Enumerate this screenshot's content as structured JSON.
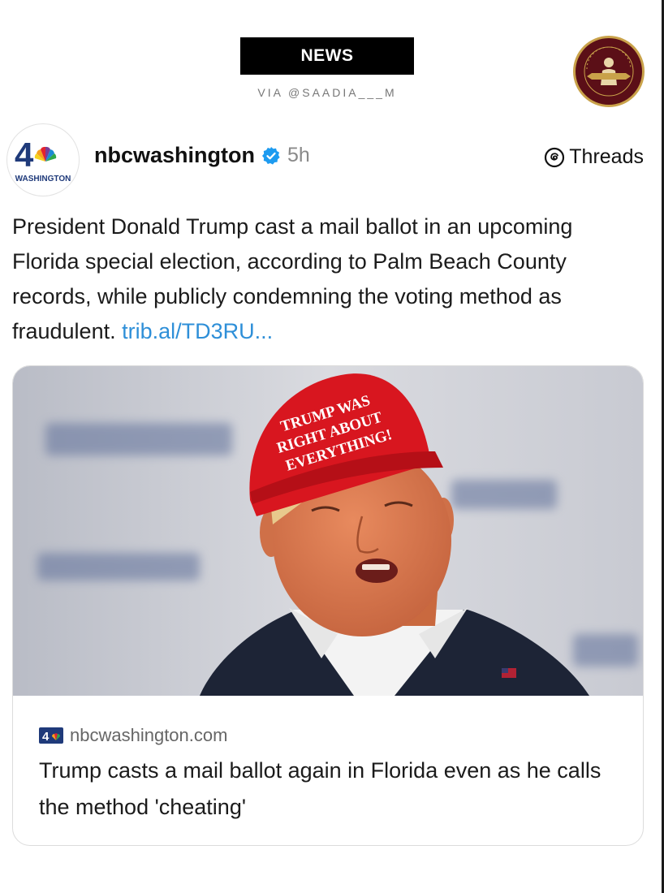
{
  "header": {
    "badge_label": "NEWS",
    "via_text": "VIA @SAADIA___M",
    "corner_logo_text": "TRUTH IS JUSTICE"
  },
  "post": {
    "avatar_number": "4",
    "avatar_caption": "WASHINGTON",
    "handle": "nbcwashington",
    "time": "5h",
    "platform": "Threads",
    "text": "President Donald Trump cast a mail ballot in an upcoming Florida special election, according to Palm Beach County records, while publicly condemning the voting method as fraudulent.",
    "link_text": "trib.al/TD3RU..."
  },
  "card": {
    "image_text": "TRUMP WAS RIGHT ABOUT EVERYTHING!",
    "source_domain": "nbcwashington.com",
    "title": "Trump casts a mail ballot again in Florida even as he calls the method 'cheating'"
  },
  "colors": {
    "link": "#2e8fd8",
    "verified": "#1d9bf0",
    "hat_red": "#d8161f",
    "logo_maroon": "#5b0f17",
    "logo_gold": "#c9a24a"
  },
  "icons": {
    "verified": "verified-badge-icon",
    "threads": "threads-icon",
    "source": "nbc-logo-icon"
  }
}
